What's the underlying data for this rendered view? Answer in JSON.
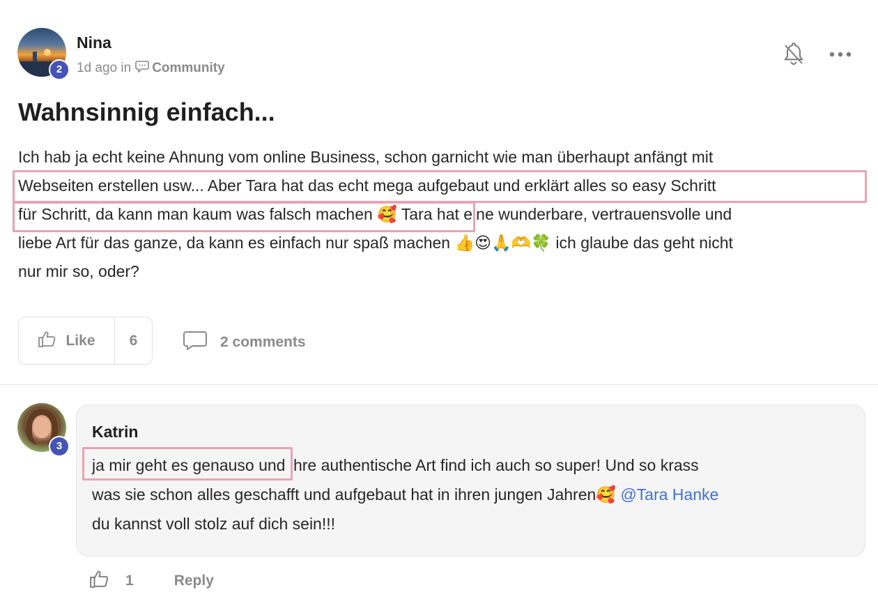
{
  "post": {
    "author": "Nina",
    "level": "2",
    "time": "1d ago in",
    "category": "Community",
    "title": "Wahnsinnig einfach...",
    "body_lines": [
      "Ich hab ja echt keine Ahnung vom online Business, schon garnicht wie man überhaupt anfängt mit",
      "Webseiten erstellen usw... Aber Tara hat das echt mega aufgebaut und erklärt alles so easy Schritt",
      "für Schritt, da kann man kaum was falsch machen 🥰 Tara hat eine wunderbare, vertrauensvolle und",
      "liebe Art für das ganze, da kann es einfach nur spaß machen 👍😍🙏🫶🍀 ich glaube das geht nicht",
      "nur mir so, oder?"
    ],
    "like_label": "Like",
    "like_count": "6",
    "comments_label": "2 comments"
  },
  "comment": {
    "author": "Katrin",
    "level": "3",
    "body_line1_highlight": "ja mir geht es genauso",
    "body_line1_rest": " und ihre authentische Art find ich auch so super! Und so krass",
    "body_line2_text": "was sie schon alles geschafft und aufgebaut hat in ihren jungen Jahren🥰 ",
    "body_line2_mention": "@Tara Hanke",
    "body_line3": "du kannst voll stolz auf dich sein!!!",
    "like_count": "1",
    "reply_label": "Reply"
  },
  "icons": {
    "notify": "bell-off-icon",
    "more": "more-horizontal-icon",
    "like": "thumbs-up-icon",
    "comments": "comment-bubble-icon",
    "category": "chat-bubble-icon"
  },
  "colors": {
    "badge": "#4552b8",
    "highlight": "#e8a3b4",
    "mention": "#3f6fd8",
    "muted": "#8a8a8a"
  }
}
